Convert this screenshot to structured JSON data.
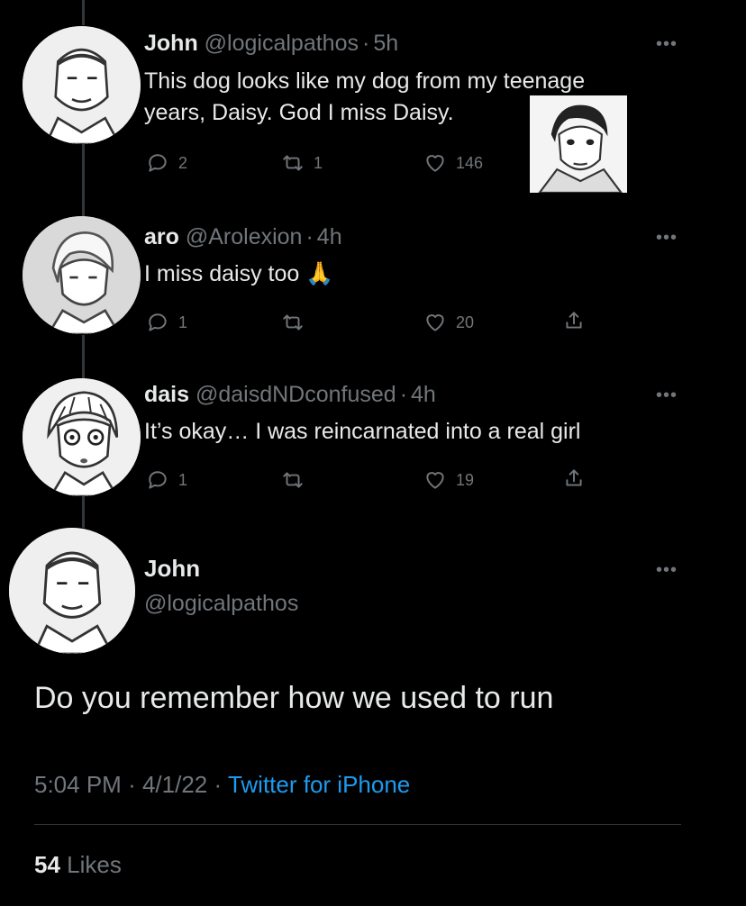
{
  "colors": {
    "background": "#000000",
    "text": "#e7e9ea",
    "muted": "#71767b",
    "link": "#1d9bf0",
    "thread_line": "#333639"
  },
  "replies": [
    {
      "name": "John",
      "handle": "@logicalpathos",
      "time": "5h",
      "text_lines": [
        "This dog looks like my dog from my teenage",
        "years, Daisy. God I miss Daisy."
      ],
      "reply_count": "2",
      "retweet_count": "1",
      "like_count": "146",
      "has_image": true,
      "icons": [
        "reply-icon",
        "retweet-icon",
        "like-icon"
      ]
    },
    {
      "name": "aro",
      "handle": "@Arolexion",
      "time": "4h",
      "text": "I miss daisy too",
      "emoji": "🙏",
      "reply_count": "1",
      "retweet_count": "",
      "like_count": "20",
      "icons": [
        "reply-icon",
        "retweet-icon",
        "like-icon",
        "share-icon"
      ]
    },
    {
      "name": "dais",
      "handle": "@daisdNDconfused",
      "time": "4h",
      "text": "It’s okay… I was reincarnated into a real girl",
      "reply_count": "1",
      "retweet_count": "",
      "like_count": "19",
      "icons": [
        "reply-icon",
        "retweet-icon",
        "like-icon",
        "share-icon"
      ]
    }
  ],
  "main_tweet": {
    "name": "John",
    "handle": "@logicalpathos",
    "text": "Do you remember how we used to run",
    "time": "5:04 PM",
    "date": "4/1/22",
    "source": "Twitter for iPhone",
    "likes_count": "54",
    "likes_label": "Likes"
  },
  "separator": "·",
  "more_label": "•••"
}
